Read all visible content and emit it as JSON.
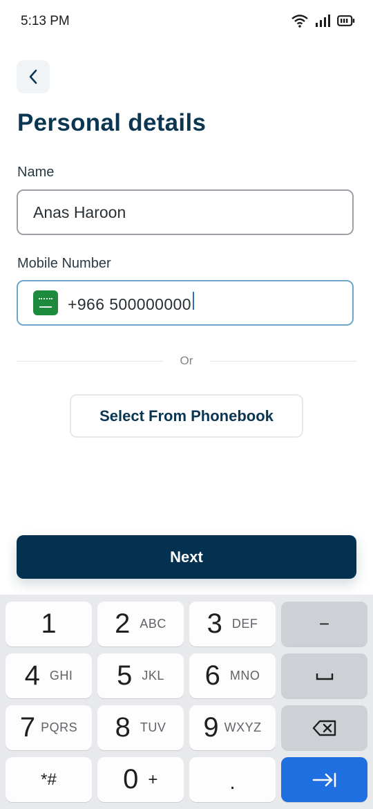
{
  "status_bar": {
    "time": "5:13 PM"
  },
  "page": {
    "title": "Personal details"
  },
  "form": {
    "name_label": "Name",
    "name_value": "Anas Haroon",
    "mobile_label": "Mobile Number",
    "country_code": "+966",
    "mobile_value": "500000000"
  },
  "divider": {
    "text": "Or"
  },
  "buttons": {
    "phonebook": "Select From Phonebook",
    "next": "Next"
  },
  "keyboard": {
    "keys": [
      {
        "num": "1",
        "letters": ""
      },
      {
        "num": "2",
        "letters": "ABC"
      },
      {
        "num": "3",
        "letters": "DEF"
      },
      {
        "num": "4",
        "letters": "GHI"
      },
      {
        "num": "5",
        "letters": "JKL"
      },
      {
        "num": "6",
        "letters": "MNO"
      },
      {
        "num": "7",
        "letters": "PQRS"
      },
      {
        "num": "8",
        "letters": "TUV"
      },
      {
        "num": "9",
        "letters": "WXYZ"
      },
      {
        "num": "*#",
        "letters": ""
      },
      {
        "num": "0",
        "letters": "+"
      },
      {
        "num": ".",
        "letters": ""
      }
    ],
    "minus": "−"
  }
}
